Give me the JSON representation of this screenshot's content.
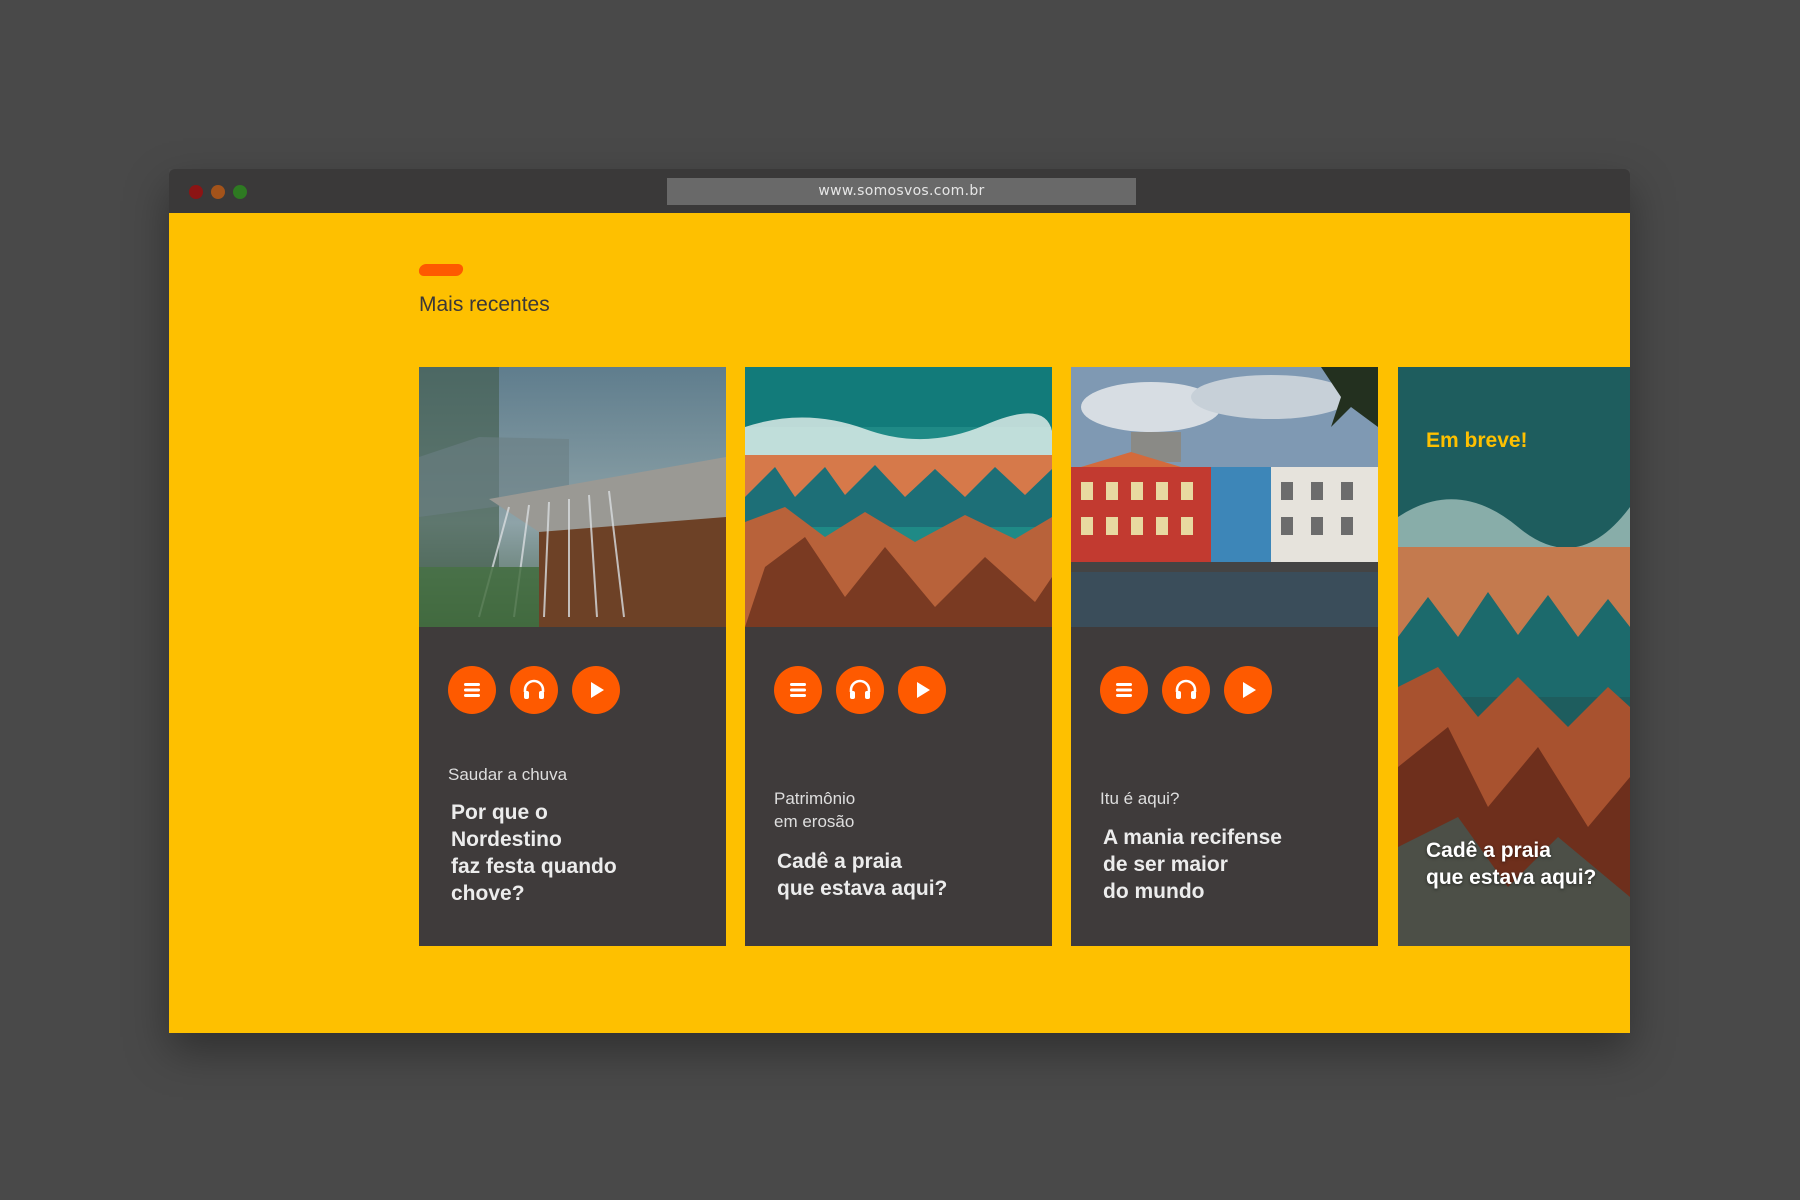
{
  "browser": {
    "url": "www.somosvos.com.br"
  },
  "page": {
    "background_color": "#fec000",
    "accent_color": "#fe5a00",
    "section_title": "Mais recentes"
  },
  "cards": [
    {
      "image": "rain-on-roof-photo",
      "actions": [
        "list-icon",
        "headphones-icon",
        "play-icon"
      ],
      "category": "Saudar a chuva",
      "title": "Por que o\nNordestino\nfaz festa quando\nchove?"
    },
    {
      "image": "aerial-beach-erosion-photo",
      "actions": [
        "list-icon",
        "headphones-icon",
        "play-icon"
      ],
      "category": "Patrimônio\nem erosão",
      "title": "Cadê a praia\nque estava aqui?"
    },
    {
      "image": "colorful-colonial-buildings-photo",
      "actions": [
        "list-icon",
        "headphones-icon",
        "play-icon"
      ],
      "category": "Itu é aqui?",
      "title": "A mania recifense\nde ser maior\ndo mundo"
    }
  ],
  "teaser": {
    "image": "aerial-beach-erosion-photo",
    "badge": "Em breve!",
    "title": "Cadê a praia\nque estava aqui?"
  }
}
